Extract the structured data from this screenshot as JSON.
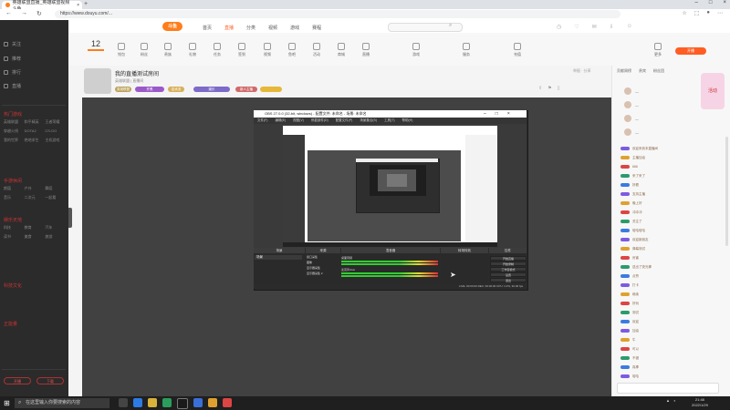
{
  "browser": {
    "tab_title": "英雄联盟直播_英雄联盟视频 斗鱼",
    "url": "https://www.douyu.com/..."
  },
  "site": {
    "logo": "斗鱼",
    "menu": [
      "首页",
      "直播",
      "分类",
      "视频",
      "游戏",
      "赛程"
    ],
    "menu_active": "直播"
  },
  "sidebar": {
    "items": [
      "关注",
      "推荐",
      "排行",
      "直播"
    ],
    "sections": [
      "热门游戏",
      "手游休闲",
      "娱乐天地",
      "科技文化",
      "正能量"
    ],
    "grid1": [
      "英雄联盟",
      "和平精英",
      "王者荣耀",
      "穿越火线",
      "DOTA2",
      "CS:GO",
      "我的世界",
      "绝地求生",
      "主机游戏"
    ],
    "grid2": [
      "颜值",
      "户外",
      "舞蹈",
      "音乐",
      "二次元",
      "一起看"
    ],
    "grid3": [
      "科技",
      "教育",
      "汽车",
      "读书",
      "美食",
      "旅游"
    ],
    "btn1": "开播",
    "btn2": "下载"
  },
  "level": {
    "value": "12"
  },
  "categories": [
    "等级",
    "钱包",
    "粉丝",
    "贵族",
    "礼物",
    "任务",
    "签到",
    "视频",
    "鱼吧",
    "活动",
    "商城",
    "直播",
    "游戏",
    "服务",
    "充值",
    "更多"
  ],
  "cat_button": "开播",
  "room": {
    "title": "我的直播测试房间",
    "subtitle": "英雄联盟 | 直播间",
    "tags": [
      "英雄联盟",
      "开黑",
      "技术流",
      "娱乐",
      "新人主播"
    ],
    "right": "举报 · 分享"
  },
  "obs": {
    "title": "OBS 27.0.0 (32-bit, windows) - 配置文件: 未命名 - 场景: 未命名",
    "menu": [
      "文件(F)",
      "编辑(E)",
      "视图(V)",
      "停靠部件(D)",
      "配置文件(P)",
      "场景集合(S)",
      "工具(T)",
      "帮助(H)"
    ],
    "docks": [
      "场景",
      "来源",
      "混音器",
      "转场特效",
      "控件"
    ],
    "scene": "场景",
    "sources": [
      "窗口采集",
      "图像",
      "显示器采集",
      "显示器采集 2"
    ],
    "mixer": [
      "桌面音频",
      "麦克风/Aux"
    ],
    "controls": [
      "开始直播",
      "开始录制",
      "工作室模式",
      "设置",
      "退出"
    ],
    "status": "LIVE: 00:00:00  REC: 00:00:00  CPU: 1.0%, 30.00 fps"
  },
  "chat": {
    "tabs": [
      "贡献周榜",
      "贵宾",
      "粉丝团"
    ],
    "promo": "活动",
    "messages": [
      "欢迎来到本直播间",
      "主播加油",
      "666",
      "来了来了",
      "好看",
      "支持主播",
      "晚上好",
      "冲冲冲",
      "关注了",
      "哈哈哈哈",
      "欢迎新朋友",
      "弹幕测试",
      "厉害",
      "送出了荧光棒",
      "点赞",
      "打卡",
      "继续",
      "好玩",
      "测试",
      "欢迎",
      "加油",
      "牛",
      "可以",
      "不错",
      "真棒",
      "哈哈"
    ]
  },
  "taskbar": {
    "search": "在这里输入你要搜索的内容",
    "time": "21:48",
    "date": "2022/1/29"
  }
}
